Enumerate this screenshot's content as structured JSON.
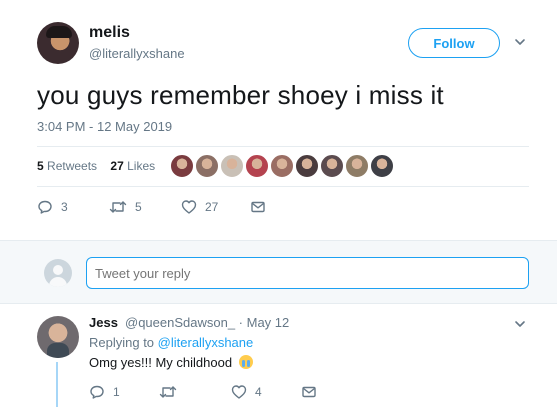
{
  "tweet": {
    "author_name": "melis",
    "author_handle": "@literallyxshane",
    "follow_label": "Follow",
    "text": "you guys remember shoey i miss it",
    "timestamp": "3:04 PM - 12 May 2019",
    "retweets_count": "5",
    "retweets_label": "Retweets",
    "likes_count": "27",
    "likes_label": "Likes",
    "actions": {
      "reply_count": "3",
      "retweet_count": "5",
      "like_count": "27"
    },
    "liker_colors": [
      "#7a3b3f",
      "#8b6f65",
      "#c9c0b6",
      "#b4434f",
      "#9a6d63",
      "#4a3c3e",
      "#5b4b4f",
      "#8e7c66",
      "#3e3f46"
    ]
  },
  "reply_box": {
    "placeholder": "Tweet your reply"
  },
  "reply": {
    "author_name": "Jess",
    "meta": "@queenSdawson_ · May 12",
    "replying_prefix": "Replying to",
    "replying_handle": "@literallyxshane",
    "text": "Omg yes!!! My childhood",
    "emoji": "crying-face",
    "actions": {
      "reply_count": "1",
      "like_count": "4"
    }
  },
  "colors": {
    "accent": "#1da1f2",
    "muted": "#657786",
    "text": "#14171a",
    "thread_line": "#a6d6f7",
    "reply_area_bg": "#f5f8fa"
  }
}
